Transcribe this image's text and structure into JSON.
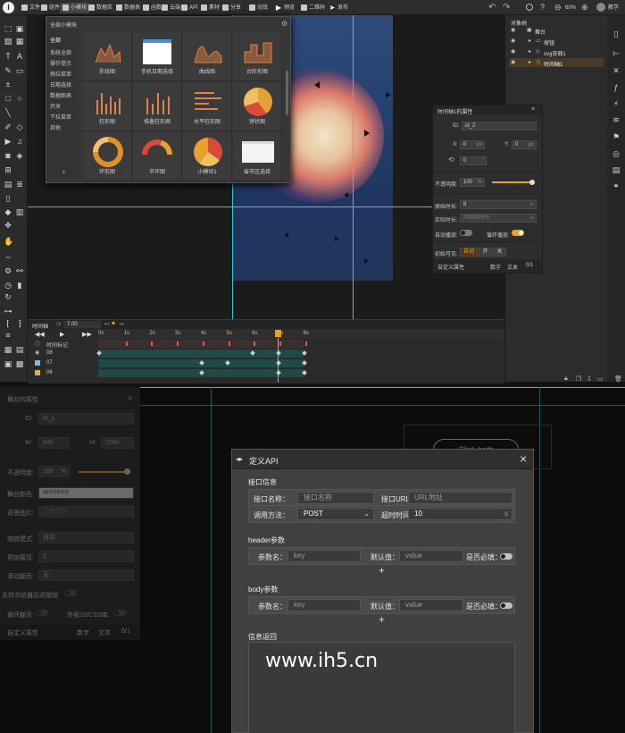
{
  "toolbar": {
    "logo": "i",
    "items": [
      "文件",
      "组件",
      "小模块",
      "数据库",
      "数据表",
      "函数",
      "云端",
      "API",
      "素材",
      "分享",
      "动效"
    ],
    "preview": "预览",
    "qr": "二维码",
    "publish": "发布",
    "zoom": "60%",
    "account": "教学"
  },
  "popup": {
    "title": "全部小模块",
    "categories": [
      "全部",
      "系统全部",
      "操作提示",
      "侧拉菜单",
      "日期选择",
      "数据图表",
      "开关",
      "下拉菜单",
      "其他"
    ],
    "tiles": [
      "折线图",
      "手机日期选择",
      "曲线图",
      "台阶形图",
      "柱形图",
      "堆叠柱形图",
      "水平柱形图",
      "饼状图",
      "环形图",
      "半环图",
      "小模块1",
      "省市区选择"
    ],
    "add": "+"
  },
  "rightpanel": {
    "title": "对象树",
    "tree": [
      "舞台",
      "按钮",
      "svg容器1",
      "时间轴1"
    ]
  },
  "props": {
    "title": "时间轴1的属性",
    "id_label": "ID:",
    "id_value": "id_2",
    "x_label": "X:",
    "x_value": "0",
    "y_label": "Y:",
    "y_value": "0",
    "rot_value": "0",
    "px": "px",
    "deg": "°",
    "opacity_label": "不透明度:",
    "opacity_value": "100",
    "pct": "%",
    "opacity_level": 1.0,
    "orig_label": "原始时长:",
    "orig_value": "8",
    "orig_unit": "s",
    "actual_label": "实际时长:",
    "actual_placeholder": "同原始时长",
    "actual_unit": "s",
    "autoplay_label": "自动播放:",
    "loop_label": "循环播放:",
    "init_label": "初始可见:",
    "init_options": [
      "自动",
      "开",
      "关"
    ],
    "custom_label": "自定义属性",
    "custom_tabs": [
      "数字",
      "文本",
      "0/1"
    ]
  },
  "timeline": {
    "title": "时间轴",
    "time": "7.00",
    "marks": [
      "0s",
      "1s",
      "2s",
      "3s",
      "4s",
      "5s",
      "6s",
      "7s",
      "8s"
    ],
    "rows": [
      "时间标记",
      "08",
      "07",
      "06"
    ]
  },
  "lower": {
    "panel_title": "舞台的属性",
    "id_label": "ID:",
    "id_value": "id_1",
    "w_label": "W:",
    "w_value": "640",
    "h_label": "H:",
    "h_value": "1040",
    "opacity_label": "不透明度:",
    "opacity_value": "100",
    "pct": "%",
    "bgcolor_label": "舞台颜色:",
    "bgcolor_value": "#FFFFFF",
    "bgimg_label": "背景图片:",
    "bgimg_placeholder": "上传图片",
    "scale_label": "缩放模式:",
    "scale_value": "自动",
    "preload_label": "预加载页:",
    "preload_value": "2",
    "slide_label": "滑动翻页:",
    "slide_value": "无",
    "browser_label": "支持浏览器后退按钮",
    "loop_label": "循环翻页:",
    "ext_label": "外部JS/CSS库:",
    "custom_label": "自定义属性",
    "custom_tabs": [
      "数字",
      "文本",
      "0/1"
    ],
    "button_text": "Click both"
  },
  "dialog": {
    "title": "定义API",
    "close": "×",
    "section1": "接口信息",
    "name_label": "接口名称：",
    "name_placeholder": "接口名称",
    "url_label": "接口URL：",
    "url_placeholder": "URL地址",
    "method_label": "调用方法：",
    "method_value": "POST",
    "timeout_label": "超时时间：",
    "timeout_value": "10",
    "timeout_unit": "s",
    "section2": "header参数",
    "param_label": "参数名：",
    "param_placeholder": "key",
    "default_label": "默认值：",
    "default_placeholder": "value",
    "required_label": "是否必填：",
    "add": "+",
    "section3": "body参数",
    "section4": "信息返回"
  },
  "watermark": "www.ih5.cn",
  "colors": {
    "accent": "#f0a020",
    "stage": "#24406e",
    "guide": "#33c8d8"
  }
}
